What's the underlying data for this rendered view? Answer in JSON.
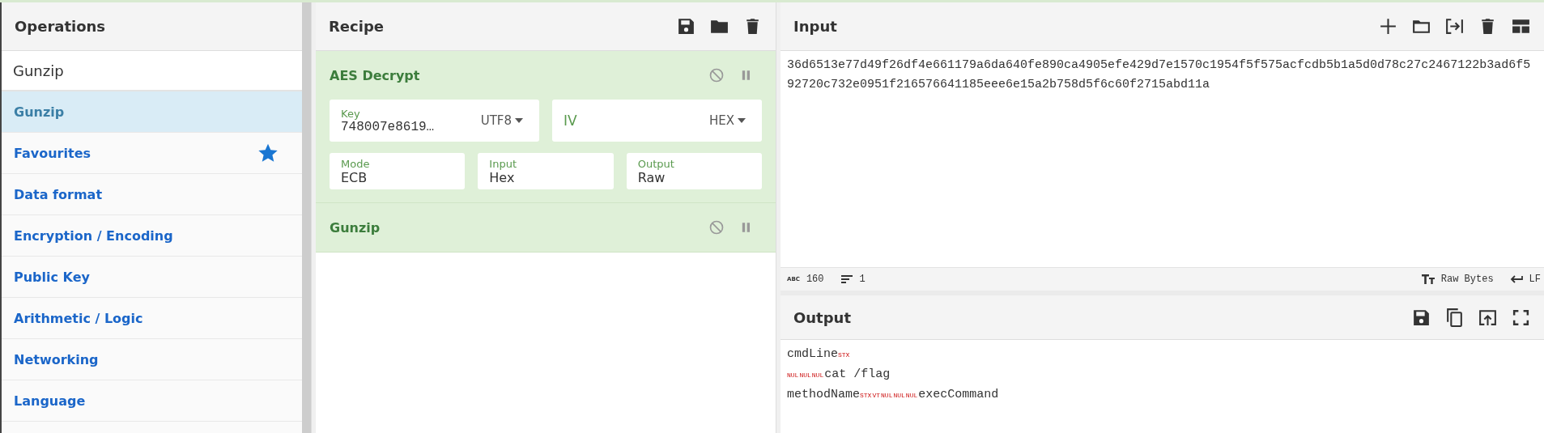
{
  "operations": {
    "title": "Operations",
    "search": {
      "value": "Gunzip"
    },
    "results": [
      {
        "label": "Gunzip",
        "selected": true
      }
    ],
    "categories": [
      {
        "label": "Favourites",
        "kind": "favourites"
      },
      {
        "label": "Data format",
        "kind": "category"
      },
      {
        "label": "Encryption / Encoding",
        "kind": "category"
      },
      {
        "label": "Public Key",
        "kind": "category"
      },
      {
        "label": "Arithmetic / Logic",
        "kind": "category"
      },
      {
        "label": "Networking",
        "kind": "category"
      },
      {
        "label": "Language",
        "kind": "category"
      }
    ]
  },
  "recipe": {
    "title": "Recipe",
    "operations": [
      {
        "name": "AES Decrypt",
        "arg_rows": [
          [
            {
              "label": "Key",
              "value": "748007e8619…",
              "encoding": "UTF8"
            },
            {
              "label": "IV",
              "encoding": "HEX"
            }
          ],
          [
            {
              "label": "Mode",
              "value": "ECB"
            },
            {
              "label": "Input",
              "value": "Hex"
            },
            {
              "label": "Output",
              "value": "Raw"
            }
          ]
        ]
      },
      {
        "name": "Gunzip"
      }
    ]
  },
  "input": {
    "title": "Input",
    "text": "36d6513e77d49f26df4e661179a6da640fe890ca4905efe429d7e1570c1954f5f575acfcdb5b1a5d0d78c27c2467122b3ad6f592720c732e0951f216576641185eee6e15a2b758d5f6c60f2715abd11a",
    "status": {
      "length_icon": "ABC",
      "length": "160",
      "lines": "1",
      "encoding": "Raw Bytes",
      "eol": "LF"
    }
  },
  "output": {
    "title": "Output",
    "lines": [
      [
        {
          "kind": "text",
          "text": "cmdLine"
        },
        {
          "kind": "control",
          "text": "STX"
        }
      ],
      [
        {
          "kind": "control",
          "text": "NUL"
        },
        {
          "kind": "control",
          "text": "NUL"
        },
        {
          "kind": "control",
          "text": "NUL"
        },
        {
          "kind": "text",
          "text": "cat /flag"
        }
      ],
      [
        {
          "kind": "text",
          "text": "methodName"
        },
        {
          "kind": "control",
          "text": "STX"
        },
        {
          "kind": "control",
          "text": "VT"
        },
        {
          "kind": "control",
          "text": "NUL"
        },
        {
          "kind": "control",
          "text": "NUL"
        },
        {
          "kind": "control",
          "text": "NUL"
        },
        {
          "kind": "text",
          "text": "execCommand"
        }
      ]
    ]
  }
}
